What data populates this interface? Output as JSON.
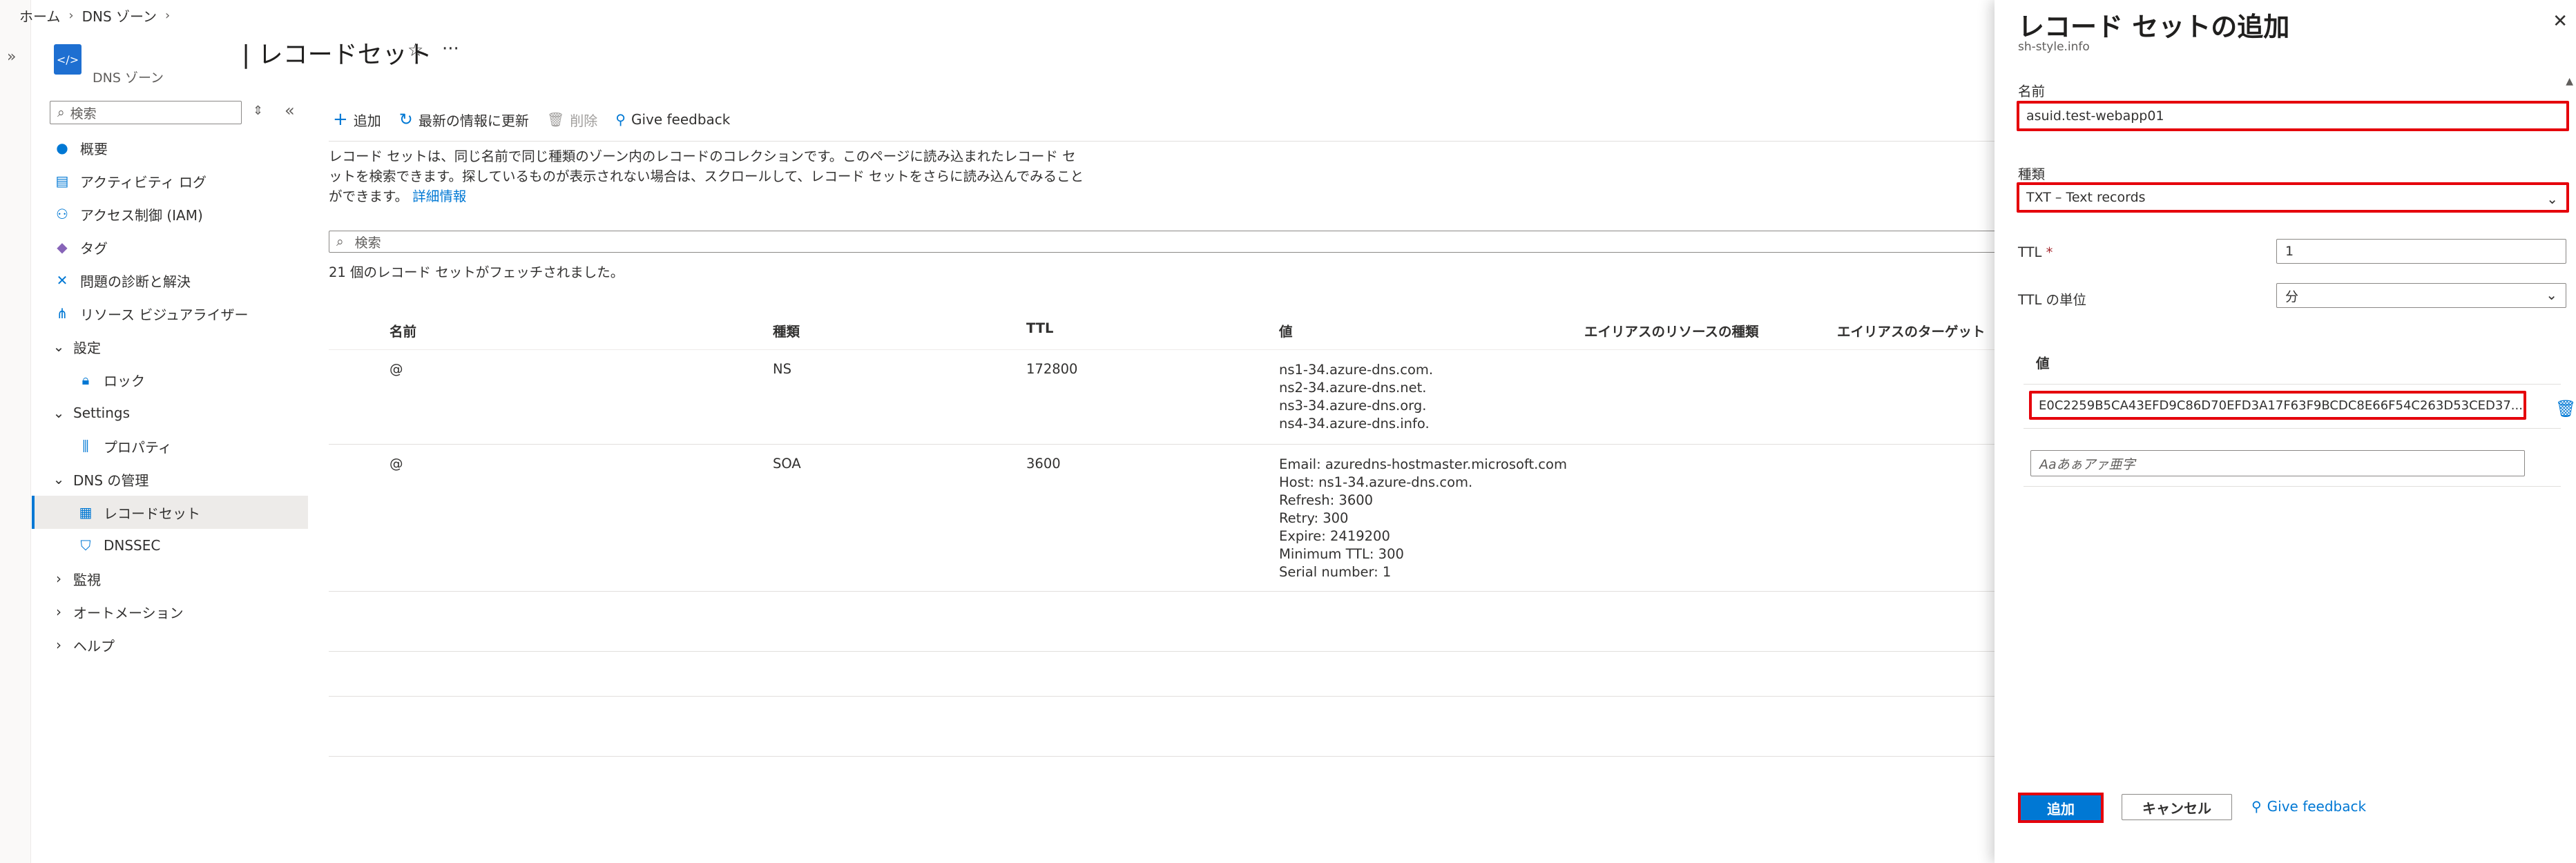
{
  "breadcrumb": [
    "ホーム",
    "DNS ゾーン"
  ],
  "resource": {
    "title": "| レコードセット",
    "subtitle": "DNS ゾーン",
    "icon": "dns-zone-icon"
  },
  "sidebar": {
    "search_placeholder": "検索",
    "items": [
      {
        "label": "概要",
        "icon": "overview-icon"
      },
      {
        "label": "アクティビティ ログ",
        "icon": "activity-log-icon"
      },
      {
        "label": "アクセス制御 (IAM)",
        "icon": "iam-icon"
      },
      {
        "label": "タグ",
        "icon": "tag-icon"
      },
      {
        "label": "問題の診断と解決",
        "icon": "diagnose-icon"
      },
      {
        "label": "リソース ビジュアライザー",
        "icon": "visualizer-icon"
      },
      {
        "label": "設定",
        "icon": "chevron-down-icon"
      },
      {
        "label": "ロック",
        "icon": "lock-icon"
      },
      {
        "label": "Settings",
        "icon": "chevron-down-icon"
      },
      {
        "label": "プロパティ",
        "icon": "properties-icon"
      },
      {
        "label": "DNS の管理",
        "icon": "chevron-down-icon"
      },
      {
        "label": "レコードセット",
        "icon": "recordset-icon"
      },
      {
        "label": "DNSSEC",
        "icon": "dnssec-icon"
      },
      {
        "label": "監視",
        "icon": "chevron-right-icon"
      },
      {
        "label": "オートメーション",
        "icon": "chevron-right-icon"
      },
      {
        "label": "ヘルプ",
        "icon": "chevron-right-icon"
      }
    ]
  },
  "toolbar": {
    "add": "追加",
    "refresh": "最新の情報に更新",
    "delete": "削除",
    "feedback": "Give feedback"
  },
  "description": {
    "line1": "レコード セットは、同じ名前で同じ種類のゾーン内のレコードのコレクションです。このページに読み込まれたレコード セ",
    "line2": "ットを検索できます。探しているものが表示されない場合は、スクロールして、レコード セットをさらに読み込んでみること",
    "line3": "ができます。",
    "link": "詳細情報"
  },
  "filter_placeholder": "検索",
  "fetch_count": "21 個のレコード セットがフェッチされました。",
  "grid": {
    "columns": [
      "名前",
      "種類",
      "TTL",
      "値",
      "エイリアスのリソースの種類",
      "エイリアスのターゲット"
    ],
    "rows": [
      {
        "name": "@",
        "type": "NS",
        "ttl": "172800",
        "values": [
          "ns1-34.azure-dns.com.",
          "ns2-34.azure-dns.net.",
          "ns3-34.azure-dns.org.",
          "ns4-34.azure-dns.info."
        ]
      },
      {
        "name": "@",
        "type": "SOA",
        "ttl": "3600",
        "values": [
          "Email: azuredns-hostmaster.microsoft.com",
          "Host: ns1-34.azure-dns.com.",
          "Refresh: 3600",
          "Retry: 300",
          "Expire: 2419200",
          "Minimum TTL: 300",
          "Serial number: 1"
        ]
      }
    ]
  },
  "panel": {
    "title": "レコード セットの追加",
    "subtitle": "sh-style.info",
    "name_label": "名前",
    "name_value": "asuid.test-webapp01",
    "type_label": "種類",
    "type_value": "TXT – Text records",
    "ttl_label": "TTL",
    "ttl_required": "*",
    "ttl_value": "1",
    "ttl_unit_label": "TTL の単位",
    "ttl_unit_value": "分",
    "value_header": "値",
    "value_entry": "E0C2259B5CA43EFD9C86D70EFD3A17F63F9BCDC8E66F54C263D53CED37...",
    "value_placeholder": "Aaあぁアァ亜字",
    "add_button": "追加",
    "cancel_button": "キャンセル",
    "feedback": "Give feedback"
  },
  "colors": {
    "accent": "#0078d4",
    "highlight": "#e5000b"
  }
}
